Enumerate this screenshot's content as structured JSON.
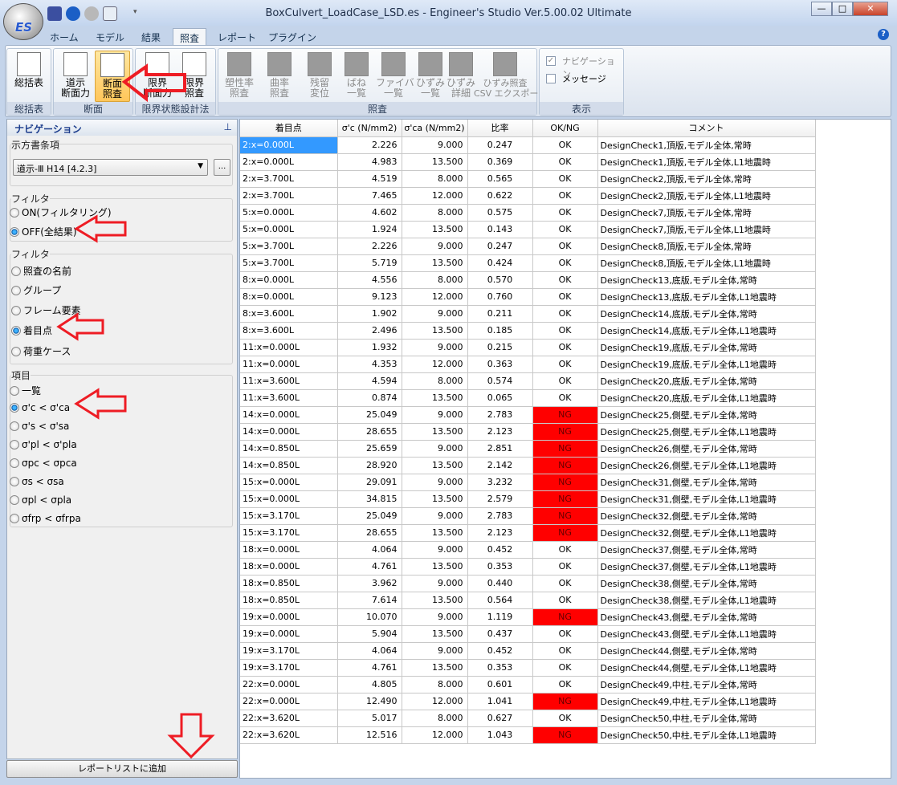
{
  "window": {
    "title": "BoxCulvert_LoadCase_LSD.es - Engineer's Studio Ver.5.00.02 Ultimate",
    "app_logo": "ES"
  },
  "tabs": [
    "ホーム",
    "モデル",
    "結果",
    "照査",
    "レポート",
    "プラグイン"
  ],
  "ribbon": {
    "groups": [
      {
        "label": "総括表",
        "buttons": [
          "総括表"
        ]
      },
      {
        "label": "断面",
        "buttons": [
          "道示\n断面力",
          "断面\n照査"
        ]
      },
      {
        "label": "限界状態設計法",
        "buttons": [
          "限界\n断面力",
          "限界\n照査"
        ]
      },
      {
        "label": "照査",
        "buttons": [
          "塑性率\n照査",
          "曲率\n照査",
          "残留\n変位",
          "ばね\n一覧",
          "ファイバ\n一覧",
          "ひずみ\n一覧",
          "ひずみ\n詳細",
          "ひずみ照査\nCSV エクスポート"
        ]
      },
      {
        "label": "表示",
        "checks": [
          {
            "label": "ナビゲーション",
            "checked": true
          },
          {
            "label": "メッセージ",
            "checked": false
          }
        ]
      }
    ]
  },
  "nav": {
    "title": "ナビゲーション",
    "spec_label": "示方書条項",
    "spec_value": "道示-Ⅲ H14 [4.2.3]",
    "browse": "...",
    "filter1_label": "フィルタ",
    "filter1": [
      {
        "label": "ON(フィルタリング)",
        "on": false
      },
      {
        "label": "OFF(全結果)",
        "on": true
      }
    ],
    "filter2_label": "フィルタ",
    "filter2": [
      {
        "label": "照査の名前",
        "on": false
      },
      {
        "label": "グループ",
        "on": false
      },
      {
        "label": "フレーム要素",
        "on": false
      },
      {
        "label": "着目点",
        "on": true
      },
      {
        "label": "荷重ケース",
        "on": false
      }
    ],
    "items_label": "項目",
    "items": [
      {
        "label": "一覧",
        "on": false
      },
      {
        "label": "σ'c < σ'ca",
        "on": true
      },
      {
        "label": "σ's < σ'sa",
        "on": false
      },
      {
        "label": "σ'pl < σ'pla",
        "on": false
      },
      {
        "label": "σpc < σpca",
        "on": false
      },
      {
        "label": "σs < σsa",
        "on": false
      },
      {
        "label": "σpl < σpla",
        "on": false
      },
      {
        "label": "σfrp < σfrpa",
        "on": false
      }
    ],
    "add_button": "レポートリストに追加"
  },
  "colors": {
    "ng": "#ff0000",
    "selected": "#3399ff",
    "annotation": "#ee1c24"
  },
  "table": {
    "headers": [
      "着目点",
      "σ'c (N/mm2)",
      "σ'ca (N/mm2)",
      "比率",
      "OK/NG",
      "コメント"
    ],
    "rows": [
      [
        "2:x=0.000L",
        "2.226",
        "9.000",
        "0.247",
        "OK",
        "DesignCheck1,頂版,モデル全体,常時"
      ],
      [
        "2:x=0.000L",
        "4.983",
        "13.500",
        "0.369",
        "OK",
        "DesignCheck1,頂版,モデル全体,L1地震時"
      ],
      [
        "2:x=3.700L",
        "4.519",
        "8.000",
        "0.565",
        "OK",
        "DesignCheck2,頂版,モデル全体,常時"
      ],
      [
        "2:x=3.700L",
        "7.465",
        "12.000",
        "0.622",
        "OK",
        "DesignCheck2,頂版,モデル全体,L1地震時"
      ],
      [
        "5:x=0.000L",
        "4.602",
        "8.000",
        "0.575",
        "OK",
        "DesignCheck7,頂版,モデル全体,常時"
      ],
      [
        "5:x=0.000L",
        "1.924",
        "13.500",
        "0.143",
        "OK",
        "DesignCheck7,頂版,モデル全体,L1地震時"
      ],
      [
        "5:x=3.700L",
        "2.226",
        "9.000",
        "0.247",
        "OK",
        "DesignCheck8,頂版,モデル全体,常時"
      ],
      [
        "5:x=3.700L",
        "5.719",
        "13.500",
        "0.424",
        "OK",
        "DesignCheck8,頂版,モデル全体,L1地震時"
      ],
      [
        "8:x=0.000L",
        "4.556",
        "8.000",
        "0.570",
        "OK",
        "DesignCheck13,底版,モデル全体,常時"
      ],
      [
        "8:x=0.000L",
        "9.123",
        "12.000",
        "0.760",
        "OK",
        "DesignCheck13,底版,モデル全体,L1地震時"
      ],
      [
        "8:x=3.600L",
        "1.902",
        "9.000",
        "0.211",
        "OK",
        "DesignCheck14,底版,モデル全体,常時"
      ],
      [
        "8:x=3.600L",
        "2.496",
        "13.500",
        "0.185",
        "OK",
        "DesignCheck14,底版,モデル全体,L1地震時"
      ],
      [
        "11:x=0.000L",
        "1.932",
        "9.000",
        "0.215",
        "OK",
        "DesignCheck19,底版,モデル全体,常時"
      ],
      [
        "11:x=0.000L",
        "4.353",
        "12.000",
        "0.363",
        "OK",
        "DesignCheck19,底版,モデル全体,L1地震時"
      ],
      [
        "11:x=3.600L",
        "4.594",
        "8.000",
        "0.574",
        "OK",
        "DesignCheck20,底版,モデル全体,常時"
      ],
      [
        "11:x=3.600L",
        "0.874",
        "13.500",
        "0.065",
        "OK",
        "DesignCheck20,底版,モデル全体,L1地震時"
      ],
      [
        "14:x=0.000L",
        "25.049",
        "9.000",
        "2.783",
        "NG",
        "DesignCheck25,側壁,モデル全体,常時"
      ],
      [
        "14:x=0.000L",
        "28.655",
        "13.500",
        "2.123",
        "NG",
        "DesignCheck25,側壁,モデル全体,L1地震時"
      ],
      [
        "14:x=0.850L",
        "25.659",
        "9.000",
        "2.851",
        "NG",
        "DesignCheck26,側壁,モデル全体,常時"
      ],
      [
        "14:x=0.850L",
        "28.920",
        "13.500",
        "2.142",
        "NG",
        "DesignCheck26,側壁,モデル全体,L1地震時"
      ],
      [
        "15:x=0.000L",
        "29.091",
        "9.000",
        "3.232",
        "NG",
        "DesignCheck31,側壁,モデル全体,常時"
      ],
      [
        "15:x=0.000L",
        "34.815",
        "13.500",
        "2.579",
        "NG",
        "DesignCheck31,側壁,モデル全体,L1地震時"
      ],
      [
        "15:x=3.170L",
        "25.049",
        "9.000",
        "2.783",
        "NG",
        "DesignCheck32,側壁,モデル全体,常時"
      ],
      [
        "15:x=3.170L",
        "28.655",
        "13.500",
        "2.123",
        "NG",
        "DesignCheck32,側壁,モデル全体,L1地震時"
      ],
      [
        "18:x=0.000L",
        "4.064",
        "9.000",
        "0.452",
        "OK",
        "DesignCheck37,側壁,モデル全体,常時"
      ],
      [
        "18:x=0.000L",
        "4.761",
        "13.500",
        "0.353",
        "OK",
        "DesignCheck37,側壁,モデル全体,L1地震時"
      ],
      [
        "18:x=0.850L",
        "3.962",
        "9.000",
        "0.440",
        "OK",
        "DesignCheck38,側壁,モデル全体,常時"
      ],
      [
        "18:x=0.850L",
        "7.614",
        "13.500",
        "0.564",
        "OK",
        "DesignCheck38,側壁,モデル全体,L1地震時"
      ],
      [
        "19:x=0.000L",
        "10.070",
        "9.000",
        "1.119",
        "NG",
        "DesignCheck43,側壁,モデル全体,常時"
      ],
      [
        "19:x=0.000L",
        "5.904",
        "13.500",
        "0.437",
        "OK",
        "DesignCheck43,側壁,モデル全体,L1地震時"
      ],
      [
        "19:x=3.170L",
        "4.064",
        "9.000",
        "0.452",
        "OK",
        "DesignCheck44,側壁,モデル全体,常時"
      ],
      [
        "19:x=3.170L",
        "4.761",
        "13.500",
        "0.353",
        "OK",
        "DesignCheck44,側壁,モデル全体,L1地震時"
      ],
      [
        "22:x=0.000L",
        "4.805",
        "8.000",
        "0.601",
        "OK",
        "DesignCheck49,中柱,モデル全体,常時"
      ],
      [
        "22:x=0.000L",
        "12.490",
        "12.000",
        "1.041",
        "NG",
        "DesignCheck49,中柱,モデル全体,L1地震時"
      ],
      [
        "22:x=3.620L",
        "5.017",
        "8.000",
        "0.627",
        "OK",
        "DesignCheck50,中柱,モデル全体,常時"
      ],
      [
        "22:x=3.620L",
        "12.516",
        "12.000",
        "1.043",
        "NG",
        "DesignCheck50,中柱,モデル全体,L1地震時"
      ]
    ]
  }
}
